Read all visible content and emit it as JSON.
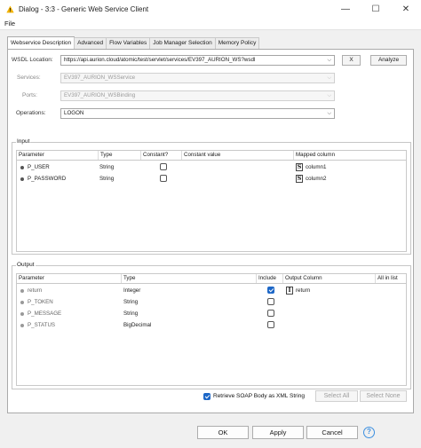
{
  "window": {
    "title": "Dialog - 3:3 - Generic Web Service Client",
    "minimize_glyph": "—",
    "maximize_glyph": "☐",
    "close_glyph": "✕"
  },
  "menu": {
    "file": "File"
  },
  "tabs": [
    {
      "label": "Webservice Description",
      "active": true
    },
    {
      "label": "Advanced"
    },
    {
      "label": "Flow Variables"
    },
    {
      "label": "Job Manager Selection"
    },
    {
      "label": "Memory Policy"
    }
  ],
  "wsdl": {
    "label": "WSDL Location:",
    "value": "https://api.aurion.cloud/atomic/test/servlet/services/EV397_AURION_WS?wsdl",
    "clear_button": "X",
    "analyze_button": "Analyze"
  },
  "services": {
    "label": "Services:",
    "value": "EV397_AURION_WSService"
  },
  "ports": {
    "label": "Ports:",
    "value": "EV397_AURION_WSBinding"
  },
  "operations": {
    "label": "Operations:",
    "value": "LOGON"
  },
  "input": {
    "title": "Input",
    "columns": [
      "Parameter",
      "Type",
      "Constant?",
      "Constant value",
      "Mapped column"
    ],
    "rows": [
      {
        "parameter": "P_USER",
        "type": "String",
        "constant": false,
        "constant_value": "",
        "type_icon": "S",
        "mapped": "column1"
      },
      {
        "parameter": "P_PASSWORD",
        "type": "String",
        "constant": false,
        "constant_value": "",
        "type_icon": "S",
        "mapped": "column2"
      }
    ]
  },
  "output": {
    "title": "Output",
    "columns": [
      "Parameter",
      "Type",
      "Include",
      "Output Column",
      "All in list"
    ],
    "rows": [
      {
        "parameter": "return",
        "type": "Integer",
        "include": true,
        "type_icon": "I",
        "output_column": "return"
      },
      {
        "parameter": "P_TOKEN",
        "type": "String",
        "include": false,
        "output_column": ""
      },
      {
        "parameter": "P_MESSAGE",
        "type": "String",
        "include": false,
        "output_column": ""
      },
      {
        "parameter": "P_STATUS",
        "type": "BigDecimal",
        "include": false,
        "output_column": ""
      }
    ]
  },
  "retrieve_soap": {
    "label": "Retrieve SOAP Body as XML String",
    "checked": true
  },
  "select_all": "Select All",
  "select_none": "Select None",
  "buttons": {
    "ok": "OK",
    "apply": "Apply",
    "cancel": "Cancel",
    "help": "?"
  },
  "colors": {
    "accent": "#1d67c7",
    "warning": "#f2b200",
    "help": "#3b8fe0"
  },
  "icons": {
    "app": "warning-triangle-icon",
    "dropdown": "chevron-down-icon",
    "help": "help-icon"
  }
}
